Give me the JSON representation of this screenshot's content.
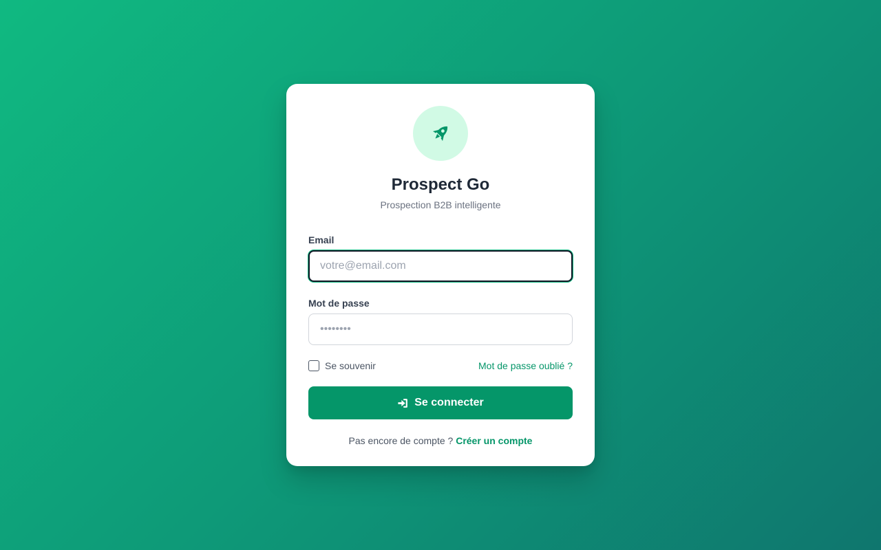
{
  "brand": {
    "icon": "rocket-icon",
    "title": "Prospect Go",
    "subtitle": "Prospection B2B intelligente"
  },
  "form": {
    "email": {
      "label": "Email",
      "value": "",
      "placeholder": "votre@email.com"
    },
    "password": {
      "label": "Mot de passe",
      "value": "",
      "placeholder": "••••••••"
    },
    "remember_label": "Se souvenir",
    "remember_checked": false,
    "forgot_link": "Mot de passe oublié ?",
    "submit_label": "Se connecter",
    "submit_icon": "sign-in-icon"
  },
  "signup": {
    "prompt": "Pas encore de compte ?",
    "link": "Créer un compte"
  },
  "colors": {
    "accent": "#059669",
    "accent_light": "#d1fae5",
    "background_start": "#10b981",
    "background_end": "#0f766e",
    "title": "#1f2937"
  }
}
